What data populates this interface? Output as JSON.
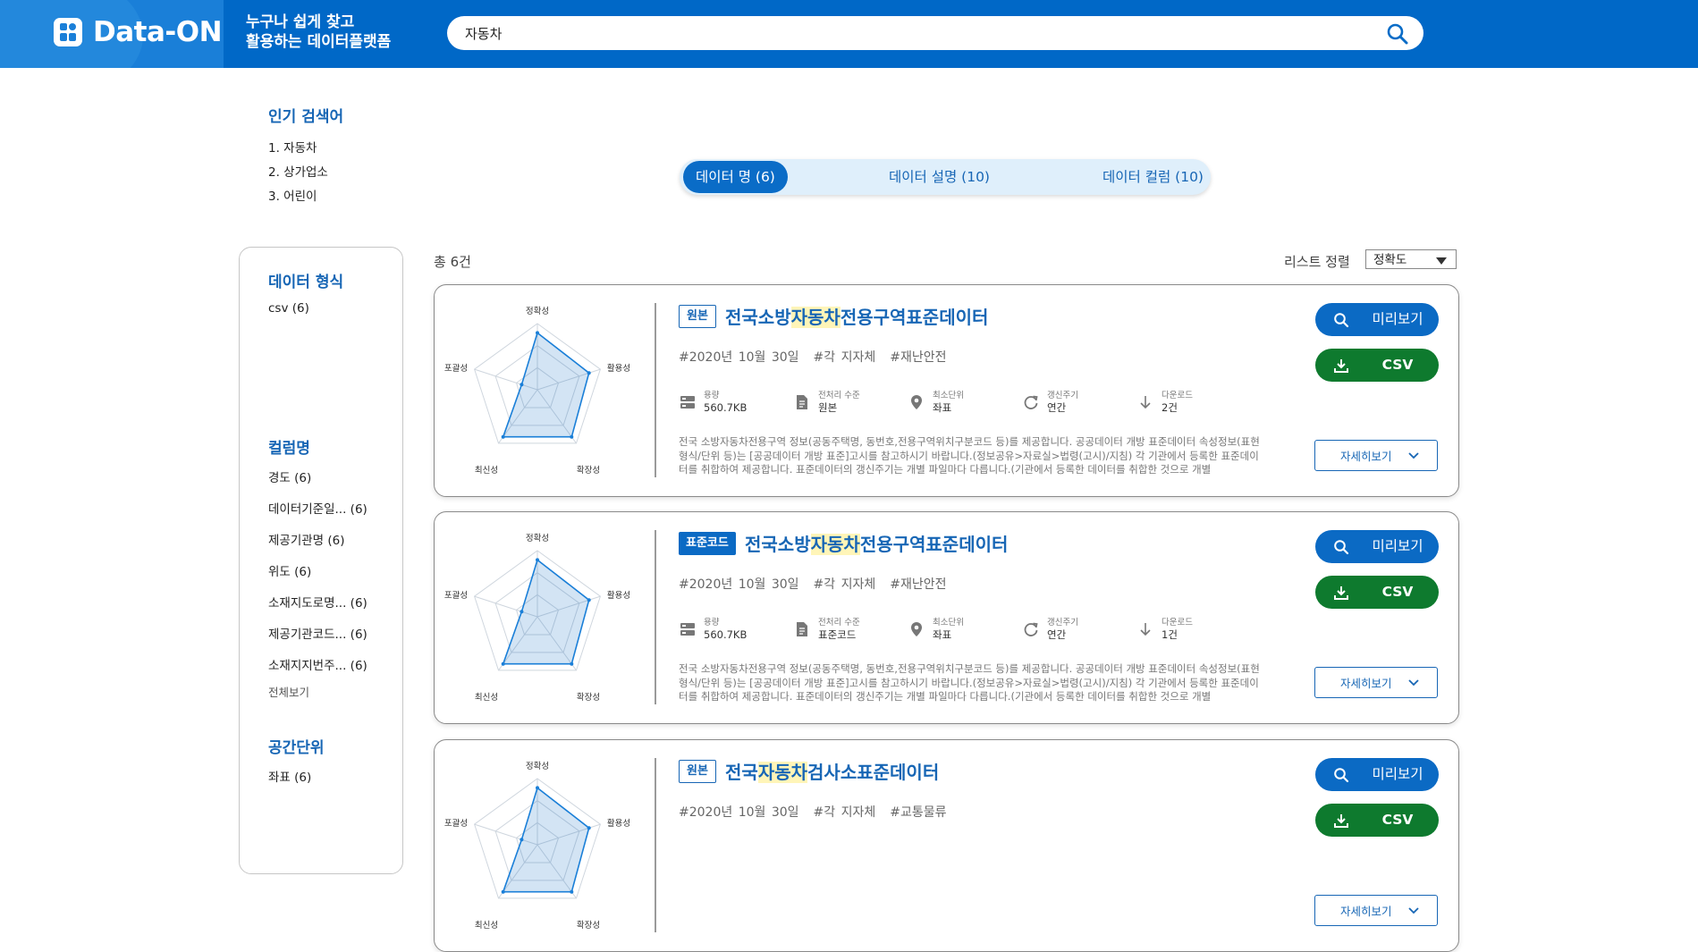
{
  "header": {
    "logo_text": "Data-ON",
    "slogan_line1": "누구나 쉽게 찾고",
    "slogan_line2": "활용하는 데이터플랫폼",
    "search_value": "자동차"
  },
  "popular": {
    "title": "인기 검색어",
    "items": [
      "1. 자동차",
      "2. 상가업소",
      "3. 어린이"
    ]
  },
  "tabs": [
    {
      "label": "데이터 명 (6)",
      "active": true
    },
    {
      "label": "데이터 설명 (10)",
      "active": false
    },
    {
      "label": "데이터 컬럼 (10)",
      "active": false
    }
  ],
  "sidebar": {
    "format_title": "데이터 형식",
    "format_items": [
      "csv (6)"
    ],
    "column_title": "컬럼명",
    "column_items": [
      "경도 (6)",
      "데이터기준일... (6)",
      "제공기관명 (6)",
      "위도 (6)",
      "소재지도로명... (6)",
      "제공기관코드... (6)",
      "소재지지번주... (6)"
    ],
    "column_more": "전체보기",
    "spatial_title": "공간단위",
    "spatial_items": [
      "좌표 (6)"
    ]
  },
  "results": {
    "total": "총 6건",
    "sort_label": "리스트 정렬",
    "sort_value": "정확도"
  },
  "radar_labels": [
    "정확성",
    "활용성",
    "확장성",
    "최신성",
    "포괄성"
  ],
  "cards": [
    {
      "badge": "원본",
      "badge_type": "orig",
      "title_pre": "전국소방",
      "title_hl": "자동차",
      "title_post": "전용구역표준데이터",
      "tags": [
        "#2020년 10월 30일",
        "#각 지자체",
        "#재난안전"
      ],
      "meta": [
        {
          "icon": "storage-icon",
          "k": "용량",
          "v": "560.7KB"
        },
        {
          "icon": "document-icon",
          "k": "전처리 수준",
          "v": "원본"
        },
        {
          "icon": "location-pin-icon",
          "k": "최소단위",
          "v": "좌표"
        },
        {
          "icon": "refresh-icon",
          "k": "갱신주기",
          "v": "연간"
        },
        {
          "icon": "download-arrow-icon",
          "k": "다운로드",
          "v": "2건"
        }
      ],
      "desc": "전국 소방자동차전용구역 정보(공동주택명, 동번호,전용구역위치구분코드 등)를 제공합니다. 공공데이터 개방 표준데이터 속성정보(표현형식/단위 등)는 [공공데이터 개방 표준]고시를 참고하시기 바랍니다.(정보공유>자료실>법령(고시)/지침) 각 기관에서 등록한 표준데이터를 취합하여 제공합니다. 표준데이터의 갱신주기는 개별 파일마다 다릅니다.(기관에서 등록한 데이터를 취합한 것으로 개별",
      "preview_label": "미리보기",
      "csv_label": "CSV",
      "detail_label": "자세히보기"
    },
    {
      "badge": "표준코드",
      "badge_type": "std",
      "title_pre": "전국소방",
      "title_hl": "자동차",
      "title_post": "전용구역표준데이터",
      "tags": [
        "#2020년 10월 30일",
        "#각 지자체",
        "#재난안전"
      ],
      "meta": [
        {
          "icon": "storage-icon",
          "k": "용량",
          "v": "560.7KB"
        },
        {
          "icon": "document-icon",
          "k": "전처리 수준",
          "v": "표준코드"
        },
        {
          "icon": "location-pin-icon",
          "k": "최소단위",
          "v": "좌표"
        },
        {
          "icon": "refresh-icon",
          "k": "갱신주기",
          "v": "연간"
        },
        {
          "icon": "download-arrow-icon",
          "k": "다운로드",
          "v": "1건"
        }
      ],
      "desc": "전국 소방자동차전용구역 정보(공동주택명, 동번호,전용구역위치구분코드 등)를 제공합니다. 공공데이터 개방 표준데이터 속성정보(표현형식/단위 등)는 [공공데이터 개방 표준]고시를 참고하시기 바랍니다.(정보공유>자료실>법령(고시)/지침) 각 기관에서 등록한 표준데이터를 취합하여 제공합니다. 표준데이터의 갱신주기는 개별 파일마다 다릅니다.(기관에서 등록한 데이터를 취합한 것으로 개별",
      "preview_label": "미리보기",
      "csv_label": "CSV",
      "detail_label": "자세히보기"
    },
    {
      "badge": "원본",
      "badge_type": "orig",
      "title_pre": "전국",
      "title_hl": "자동차",
      "title_post": "검사소표준데이터",
      "tags": [
        "#2020년 10월 30일",
        "#각 지자체",
        "#교통물류"
      ],
      "meta": [],
      "desc": "",
      "preview_label": "미리보기",
      "csv_label": "CSV",
      "detail_label": "자세히보기"
    }
  ],
  "colors": {
    "header": "#0068c7",
    "accent": "#1766b5",
    "csv_green": "#0e7a2e",
    "highlight": "#fff5b8"
  }
}
